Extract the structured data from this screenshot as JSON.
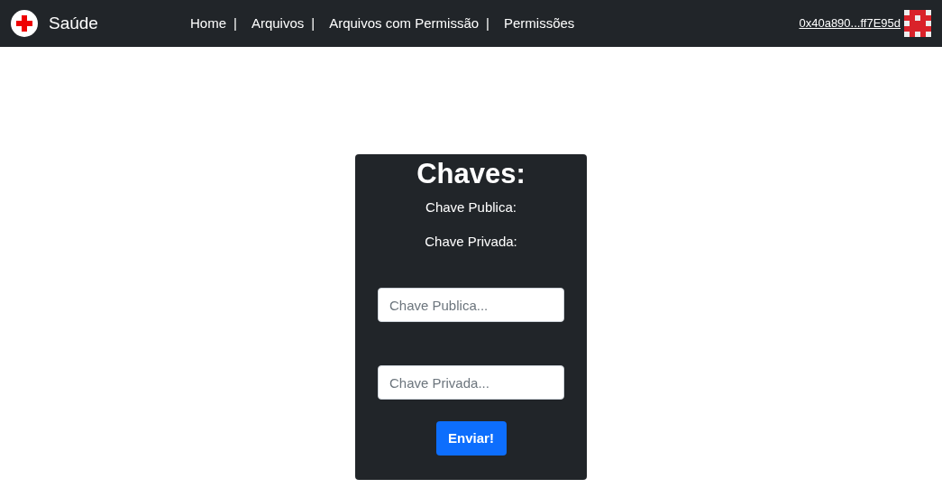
{
  "navbar": {
    "brand": "Saúde",
    "links": [
      {
        "label": "Home",
        "separator": "|"
      },
      {
        "label": "Arquivos",
        "separator": "|"
      },
      {
        "label": "Arquivos com Permissão",
        "separator": "|"
      },
      {
        "label": "Permissões"
      }
    ],
    "account": "0x40a890...ff7E95d"
  },
  "card": {
    "title": "Chaves:",
    "labels": [
      "Chave Publica:",
      "Chave Privada:"
    ],
    "fields": [
      {
        "placeholder": "Chave Publica..."
      },
      {
        "placeholder": "Chave Privada..."
      }
    ],
    "button": "Enviar!"
  }
}
